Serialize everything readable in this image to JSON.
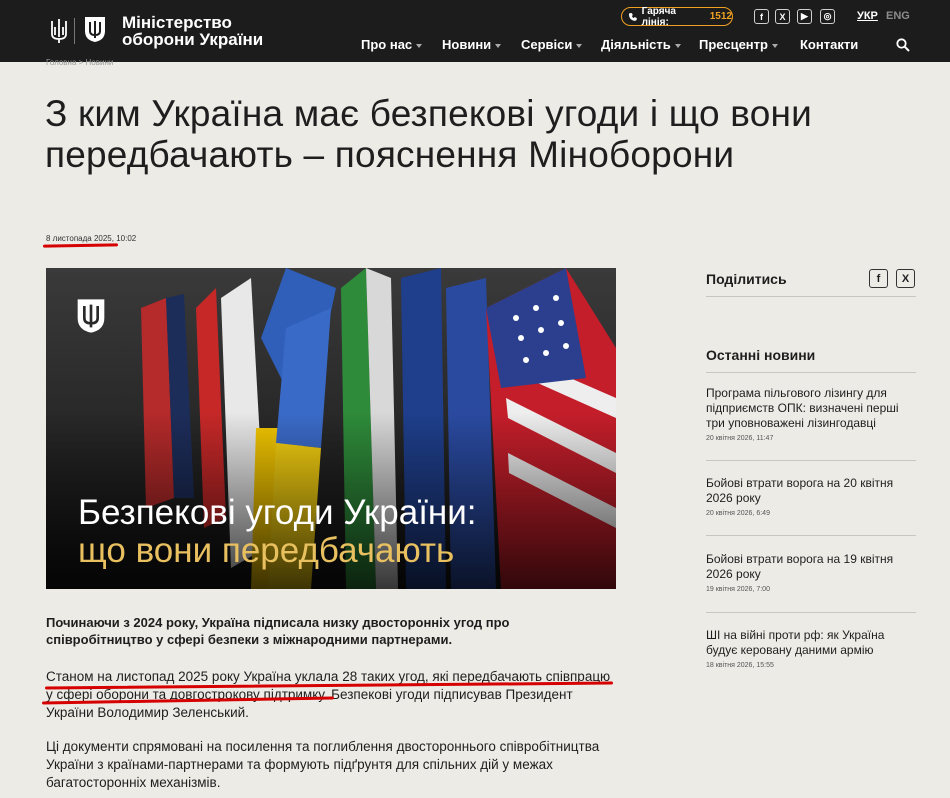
{
  "header": {
    "brand_line1": "Міністерство",
    "brand_line2": "оборони України",
    "hotline_label": "Гаряча лінія:",
    "hotline_number": "1512",
    "lang_ukr": "УКР",
    "lang_eng": "ENG",
    "nav": [
      "Про нас",
      "Новини",
      "Сервіси",
      "Діяльність",
      "Пресцентр",
      "Контакти"
    ],
    "social_icons": [
      "facebook-icon",
      "x-icon",
      "youtube-icon",
      "instagram-icon"
    ]
  },
  "breadcrumb": "Головна  >  Новини",
  "article": {
    "title": "З ким Україна має безпекові угоди і що вони передбачають – пояснення Міноборони",
    "date": "8 листопада 2025, 10:02",
    "hero_line1": "Безпекові угоди України:",
    "hero_line2": "що вони передбачають",
    "lead": "Починаючи з 2024 року, Україна підписала низку двосторонніх угод про співробітництво у сфері безпеки з міжнародними партнерами.",
    "para1_line1": "Станом на листопад 2025 року Україна уклала 28 таких угод, які передбачають співпрацю",
    "para1_line2_a": "у сфері оборони та довгострокову підтримку",
    "para1_line2_b": ". Безпекові угоди підписував Президент",
    "para1_line3": "України Володимир Зеленський.",
    "para2": "Ці документи спрямовані на посилення та поглиблення двостороннього співробітництва України з країнами-партнерами та формують підґрунтя для спільних дій у межах багатосторонніх механізмів."
  },
  "sidebar": {
    "share_title": "Поділитись",
    "share_fb": "f",
    "share_x": "X",
    "latest_title": "Останні новини",
    "news": [
      {
        "title": "Програма пільгового лізингу для підприємств ОПК: визначені перші три уповноважені лізингодавці",
        "date": "20 квітня 2026, 11:47"
      },
      {
        "title": "Бойові втрати ворога на 20 квітня 2026 року",
        "date": "20 квітня 2026, 6:49"
      },
      {
        "title": "Бойові втрати ворога на 19 квітня 2026 року",
        "date": "19 квітня 2026, 7:00"
      },
      {
        "title": "ШІ на війні проти рф: як Україна будує керовану даними армію",
        "date": "18 квітня 2026, 15:55"
      }
    ]
  },
  "colors": {
    "header_bg": "#1c1c1c",
    "accent_orange": "#f0a020",
    "annotation_red": "#d60000",
    "page_bg": "#edebe6"
  }
}
